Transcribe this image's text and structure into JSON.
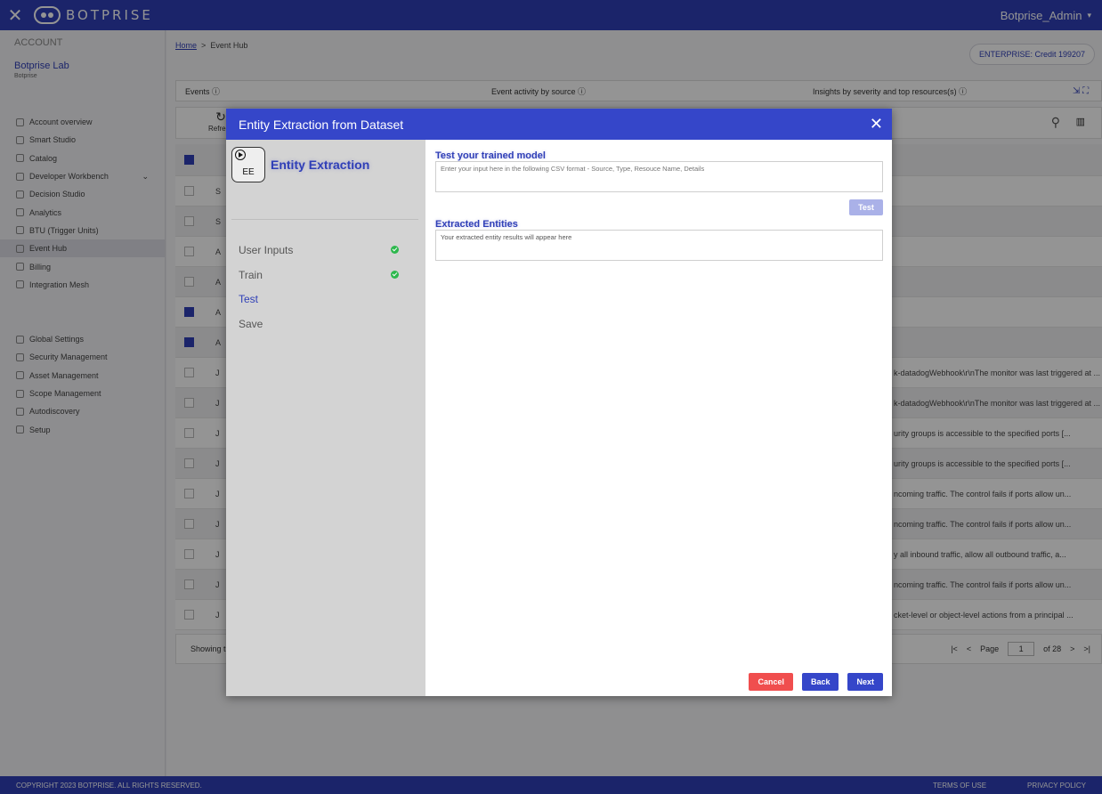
{
  "topbar": {
    "close_glyph": "✕",
    "brand": "BOTPRISE",
    "user": "Botprise_Admin",
    "user_caret": "▾"
  },
  "sidebar": {
    "account_label": "ACCOUNT",
    "account_name": "Botprise Lab",
    "account_sub": "Botprise",
    "items": [
      {
        "label": "Account overview",
        "icon": "grid-icon"
      },
      {
        "label": "Smart Studio",
        "icon": "studio-icon"
      },
      {
        "label": "Catalog",
        "icon": "catalog-icon"
      },
      {
        "label": "Developer Workbench",
        "icon": "workbench-icon",
        "chevron": "⌄"
      },
      {
        "label": "Decision Studio",
        "icon": "decision-icon"
      },
      {
        "label": "Analytics",
        "icon": "analytics-icon"
      },
      {
        "label": "BTU (Trigger Units)",
        "icon": "btu-icon"
      },
      {
        "label": "Event Hub",
        "icon": "event-hub-icon",
        "active": true
      },
      {
        "label": "Billing",
        "icon": "billing-icon"
      },
      {
        "label": "Integration Mesh",
        "icon": "mesh-icon"
      }
    ],
    "settings_items": [
      {
        "label": "Global Settings",
        "icon": "gear-icon"
      },
      {
        "label": "Security Management",
        "icon": "shield-icon"
      },
      {
        "label": "Asset Management",
        "icon": "asset-icon"
      },
      {
        "label": "Scope Management",
        "icon": "scope-icon"
      },
      {
        "label": "Autodiscovery",
        "icon": "discovery-icon"
      },
      {
        "label": "Setup",
        "icon": "setup-icon"
      }
    ]
  },
  "main": {
    "breadcrumb_home": "Home",
    "breadcrumb_sep": ">",
    "breadcrumb_current": "Event Hub",
    "enterprise_badge": "ENTERPRISE: Credit 199207",
    "tabs": [
      "Events ⓘ",
      "Event activity by source ⓘ",
      "Insights by severity and top resources(s) ⓘ"
    ],
    "expand_glyph": "⇲ ⛶",
    "refresh_label": "Refresh",
    "refresh_glyph": "↻",
    "search_glyph": "⚲",
    "columns_glyph": "▥",
    "rows": [
      {
        "c1": "S",
        "desc": "",
        "checked": false
      },
      {
        "c1": "S",
        "desc": "",
        "checked": false
      },
      {
        "c1": "A",
        "desc": "",
        "checked": false
      },
      {
        "c1": "A",
        "desc": "",
        "checked": false
      },
      {
        "c1": "A",
        "desc": "",
        "checked": true
      },
      {
        "c1": "A",
        "desc": "",
        "checked": true
      },
      {
        "c1": "J",
        "desc": "k-datadogWebhook\\r\\nThe monitor was last triggered at ...",
        "checked": false
      },
      {
        "c1": "J",
        "desc": "k-datadogWebhook\\r\\nThe monitor was last triggered at ...",
        "checked": false
      },
      {
        "c1": "J",
        "desc": "urity groups is accessible to the specified ports [...",
        "checked": false
      },
      {
        "c1": "J",
        "desc": "urity groups is accessible to the specified ports [...",
        "checked": false
      },
      {
        "c1": "J",
        "desc": "ncoming traffic. The control fails if ports allow un...",
        "checked": false
      },
      {
        "c1": "J",
        "desc": "ncoming traffic. The control fails if ports allow un...",
        "checked": false
      },
      {
        "c1": "J",
        "desc": "y all inbound traffic, allow all outbound traffic, a...",
        "checked": false
      },
      {
        "c1": "J",
        "desc": "ncoming traffic. The control fails if ports allow un...",
        "checked": false
      },
      {
        "c1": "J",
        "desc": "cket-level or object-level actions from a principal ...",
        "checked": false
      }
    ],
    "showing": "Showing t",
    "pager": {
      "first": "|<",
      "prev": "<",
      "page_label": "Page",
      "page": "1",
      "of": "of 28",
      "next": ">",
      "last": ">|"
    }
  },
  "footer": {
    "copyright": "COPYRIGHT 2023 BOTPRISE. ALL RIGHTS RESERVED.",
    "terms": "TERMS OF USE",
    "privacy": "PRIVACY POLICY"
  },
  "modal": {
    "title": "Entity Extraction from Dataset",
    "close_glyph": "✕",
    "ee_label": "EE",
    "panel_title": "Entity Extraction",
    "steps": [
      {
        "label": "User Inputs",
        "done": true
      },
      {
        "label": "Train",
        "done": true
      },
      {
        "label": "Test",
        "active": true
      },
      {
        "label": "Save"
      }
    ],
    "test_title": "Test your trained model",
    "test_placeholder": "Enter your input here in the following CSV format - Source, Type, Resouce Name, Details",
    "test_button": "Test",
    "extracted_title": "Extracted Entities",
    "extracted_placeholder": "Your extracted entity results will appear here",
    "cancel": "Cancel",
    "back": "Back",
    "next": "Next"
  },
  "colors": {
    "brand": "#2f3fb7",
    "modal_header": "#3546c9",
    "cancel": "#f04e4e",
    "success": "#2db84d"
  }
}
